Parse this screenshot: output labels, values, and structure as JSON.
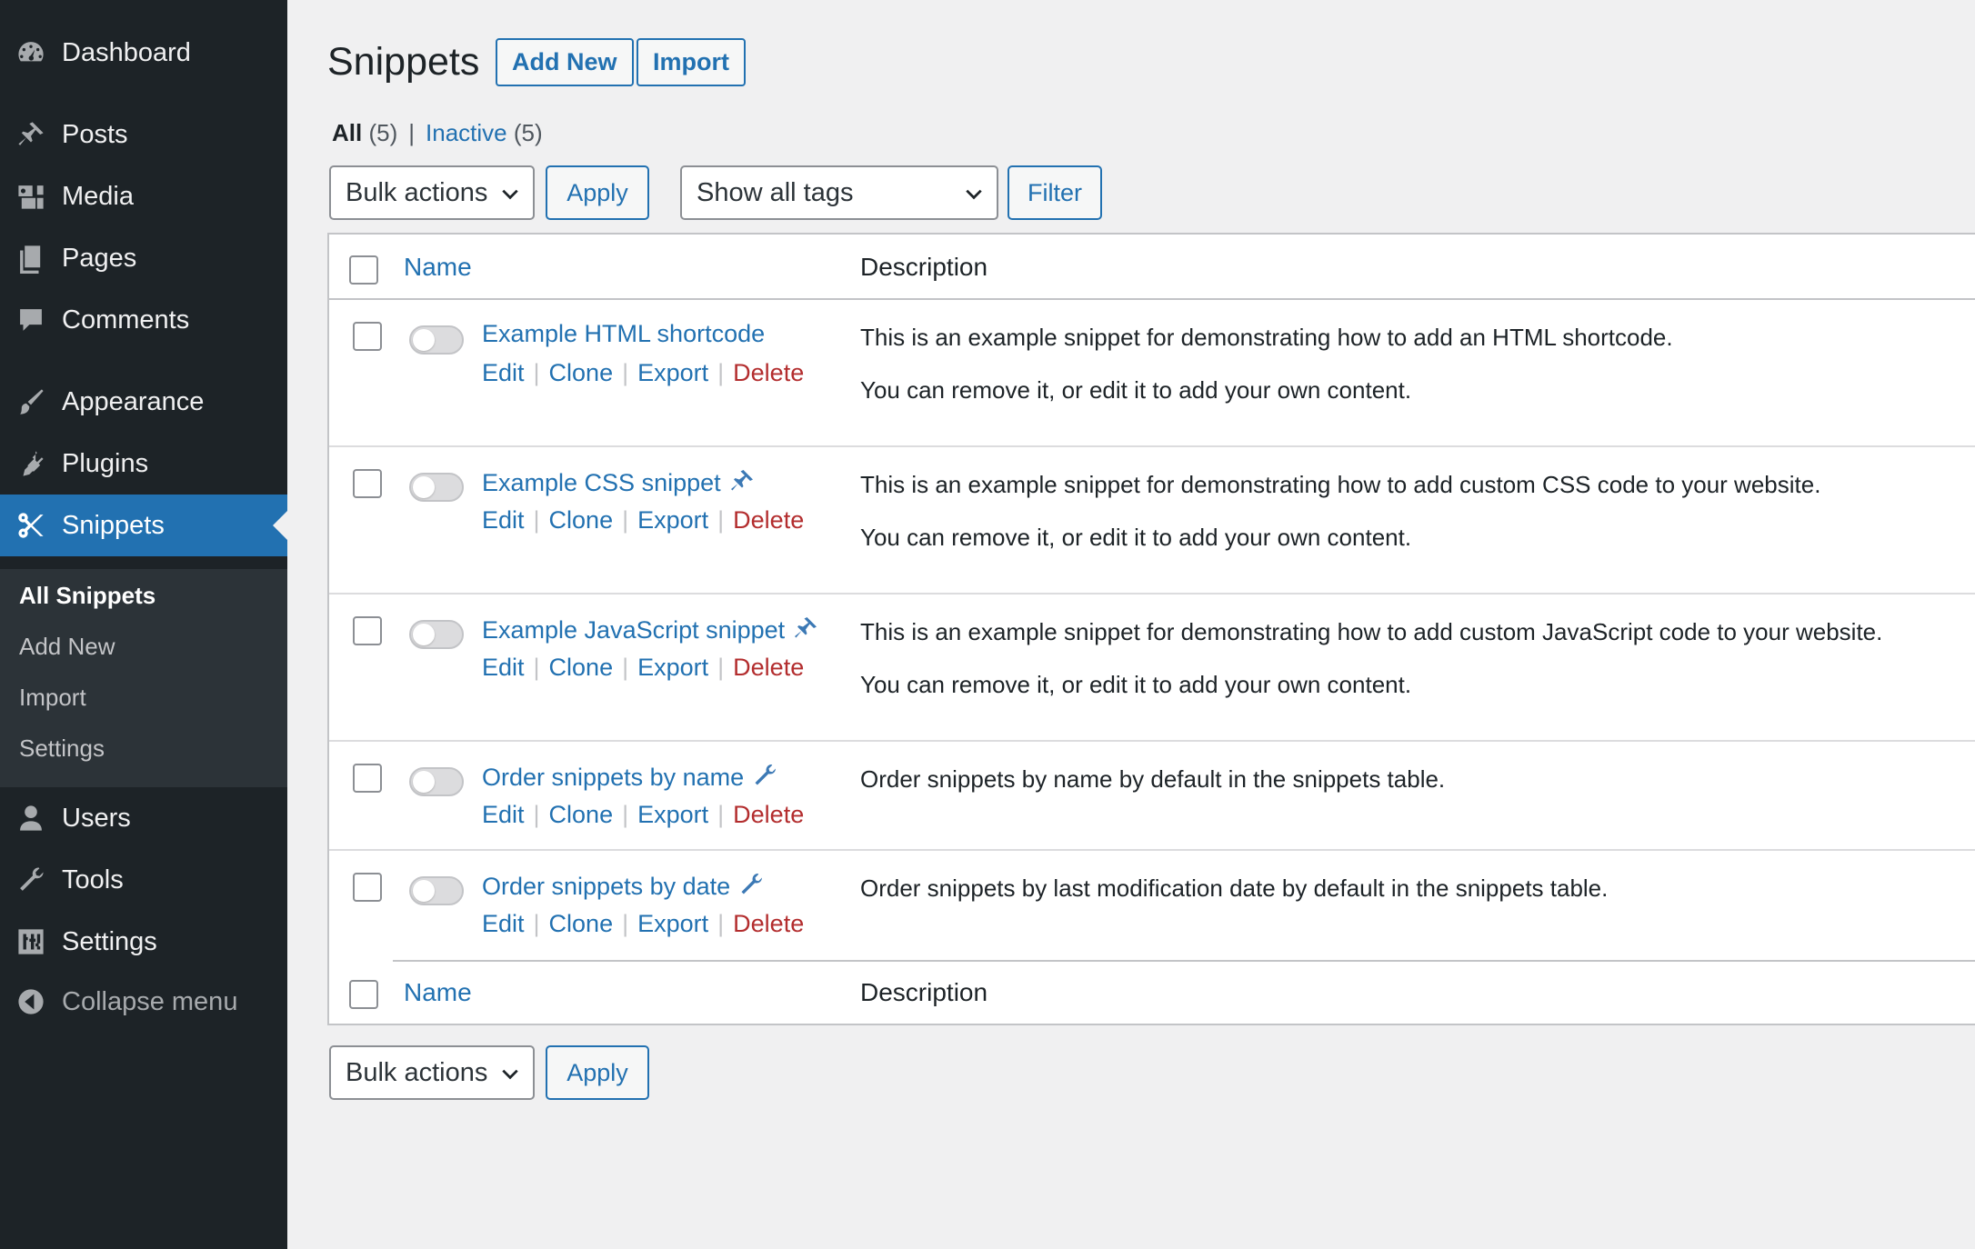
{
  "sidebar": {
    "items": [
      {
        "label": "Dashboard",
        "icon": "dashboard-icon"
      },
      {
        "label": "Posts",
        "icon": "pin-icon"
      },
      {
        "label": "Media",
        "icon": "media-icon"
      },
      {
        "label": "Pages",
        "icon": "pages-icon"
      },
      {
        "label": "Comments",
        "icon": "comment-icon"
      },
      {
        "label": "Appearance",
        "icon": "paintbrush-icon"
      },
      {
        "label": "Plugins",
        "icon": "plug-icon"
      },
      {
        "label": "Snippets",
        "icon": "scissors-icon"
      },
      {
        "label": "Users",
        "icon": "user-icon"
      },
      {
        "label": "Tools",
        "icon": "wrench-icon"
      },
      {
        "label": "Settings",
        "icon": "sliders-icon"
      },
      {
        "label": "Collapse menu",
        "icon": "collapse-icon"
      }
    ],
    "submenu": [
      "All Snippets",
      "Add New",
      "Import",
      "Settings"
    ],
    "colors": {
      "background": "#1d2327",
      "current": "#2271b1",
      "submenu_bg": "#2c3338"
    }
  },
  "header": {
    "title": "Snippets",
    "add_new": "Add New",
    "import": "Import"
  },
  "views": {
    "all_label": "All",
    "all_count": "(5)",
    "separator": "|",
    "inactive_label": "Inactive",
    "inactive_count": "(5)"
  },
  "toolbar": {
    "bulk_actions": "Bulk actions",
    "apply": "Apply",
    "tags": "Show all tags",
    "filter": "Filter"
  },
  "table": {
    "col_name": "Name",
    "col_description": "Description",
    "actions": {
      "edit": "Edit",
      "clone": "Clone",
      "export": "Export",
      "delete": "Delete"
    },
    "rows": [
      {
        "name": "Example HTML shortcode",
        "icon": "",
        "active": false,
        "desc1": "This is an example snippet for demonstrating how to add an HTML shortcode.",
        "desc2": "You can remove it, or edit it to add your own content."
      },
      {
        "name": "Example CSS snippet",
        "icon": "pin-icon",
        "active": false,
        "desc1": "This is an example snippet for demonstrating how to add custom CSS code to your website.",
        "desc2": "You can remove it, or edit it to add your own content."
      },
      {
        "name": "Example JavaScript snippet",
        "icon": "pin-icon",
        "active": false,
        "desc1": "This is an example snippet for demonstrating how to add custom JavaScript code to your website.",
        "desc2": "You can remove it, or edit it to add your own content."
      },
      {
        "name": "Order snippets by name",
        "icon": "wrench-icon",
        "active": false,
        "desc1": "Order snippets by name by default in the snippets table.",
        "desc2": ""
      },
      {
        "name": "Order snippets by date",
        "icon": "wrench-icon",
        "active": false,
        "desc1": "Order snippets by last modification date by default in the snippets table.",
        "desc2": ""
      }
    ]
  },
  "colors": {
    "link": "#2271b1",
    "delete": "#b32d2e",
    "page_bg": "#f0f0f1"
  }
}
